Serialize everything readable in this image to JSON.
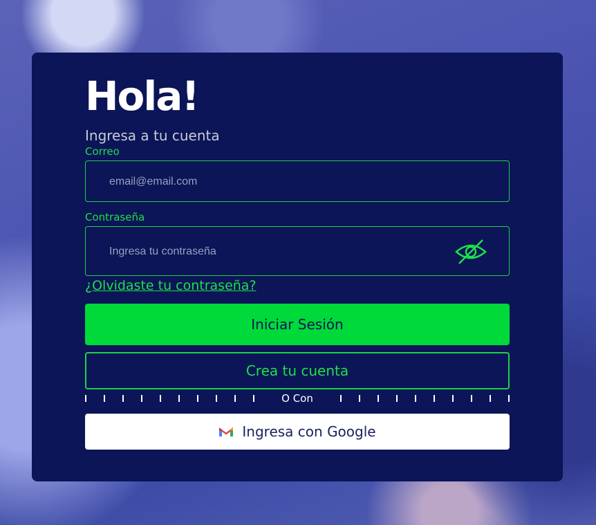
{
  "login": {
    "title": "Hola!",
    "subtitle": "Ingresa a tu cuenta",
    "email": {
      "label": "Correo",
      "placeholder": "email@email.com",
      "value": ""
    },
    "password": {
      "label": "Contraseña",
      "placeholder": "Ingresa tu contraseña",
      "value": ""
    },
    "forgot_link": "¿Olvidaste tu contraseña?",
    "login_button": "Iniciar Sesión",
    "create_button": "Crea tu cuenta",
    "divider_text": "O Con",
    "google_button": "Ingresa con Google"
  },
  "colors": {
    "card": "#0b1557",
    "accent": "#00d93a",
    "white": "#ffffff"
  },
  "icons": {
    "password_toggle": "eye-off-icon",
    "google": "gmail-icon"
  }
}
